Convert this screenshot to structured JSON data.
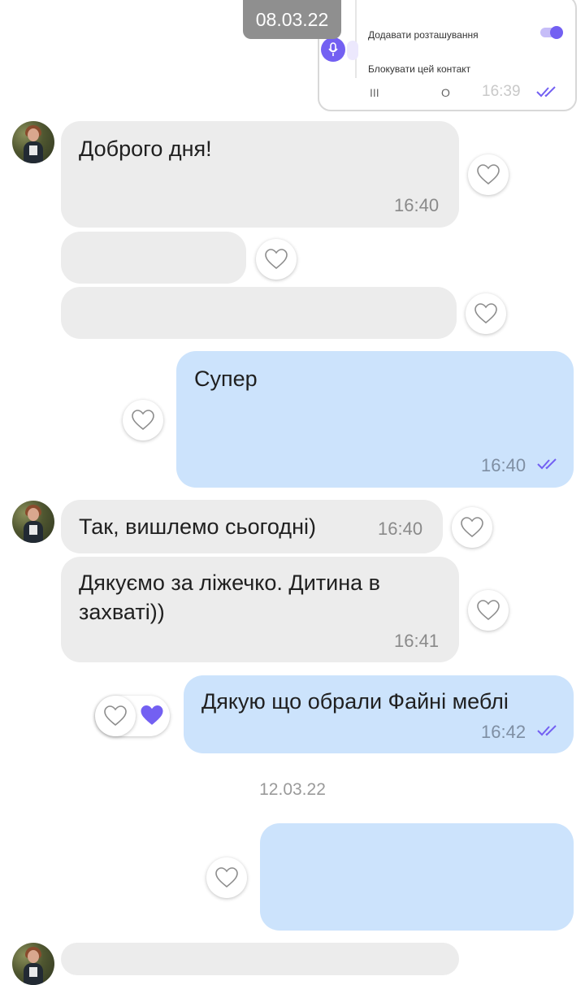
{
  "top_date_pill": "08.03.22",
  "embedded_screenshot": {
    "row1_label": "Додавати розташування",
    "row2_label": "Блокувати цей контакт",
    "time": "16:39",
    "nav_recents": "III",
    "nav_home": "O"
  },
  "messages": [
    {
      "dir": "in",
      "text": "Доброго дня!",
      "time": "16:40"
    },
    {
      "dir": "in",
      "text": "",
      "time": ""
    },
    {
      "dir": "in",
      "text": "",
      "time": ""
    },
    {
      "dir": "out",
      "text": "Супер",
      "time": "16:40"
    },
    {
      "dir": "in",
      "text": "Так, вишлемо сьогодні)",
      "time": "16:40"
    },
    {
      "dir": "in",
      "text": "Дякуємо за ліжечко. Дитина в захваті))",
      "time": "16:41"
    },
    {
      "dir": "out",
      "text": "Дякую що обрали Файні меблі",
      "time": "16:42"
    },
    {
      "dir": "out",
      "text": "",
      "time": ""
    }
  ],
  "date_separator": "12.03.22",
  "colors": {
    "incoming_bubble": "#ececec",
    "outgoing_bubble": "#cce3fc",
    "accent": "#7360f2",
    "date_pill": "#8f8f8f"
  },
  "icons": {
    "like": "heart-outline-icon",
    "liked": "heart-filled-icon",
    "read": "double-check-icon",
    "mic": "microphone-icon"
  }
}
